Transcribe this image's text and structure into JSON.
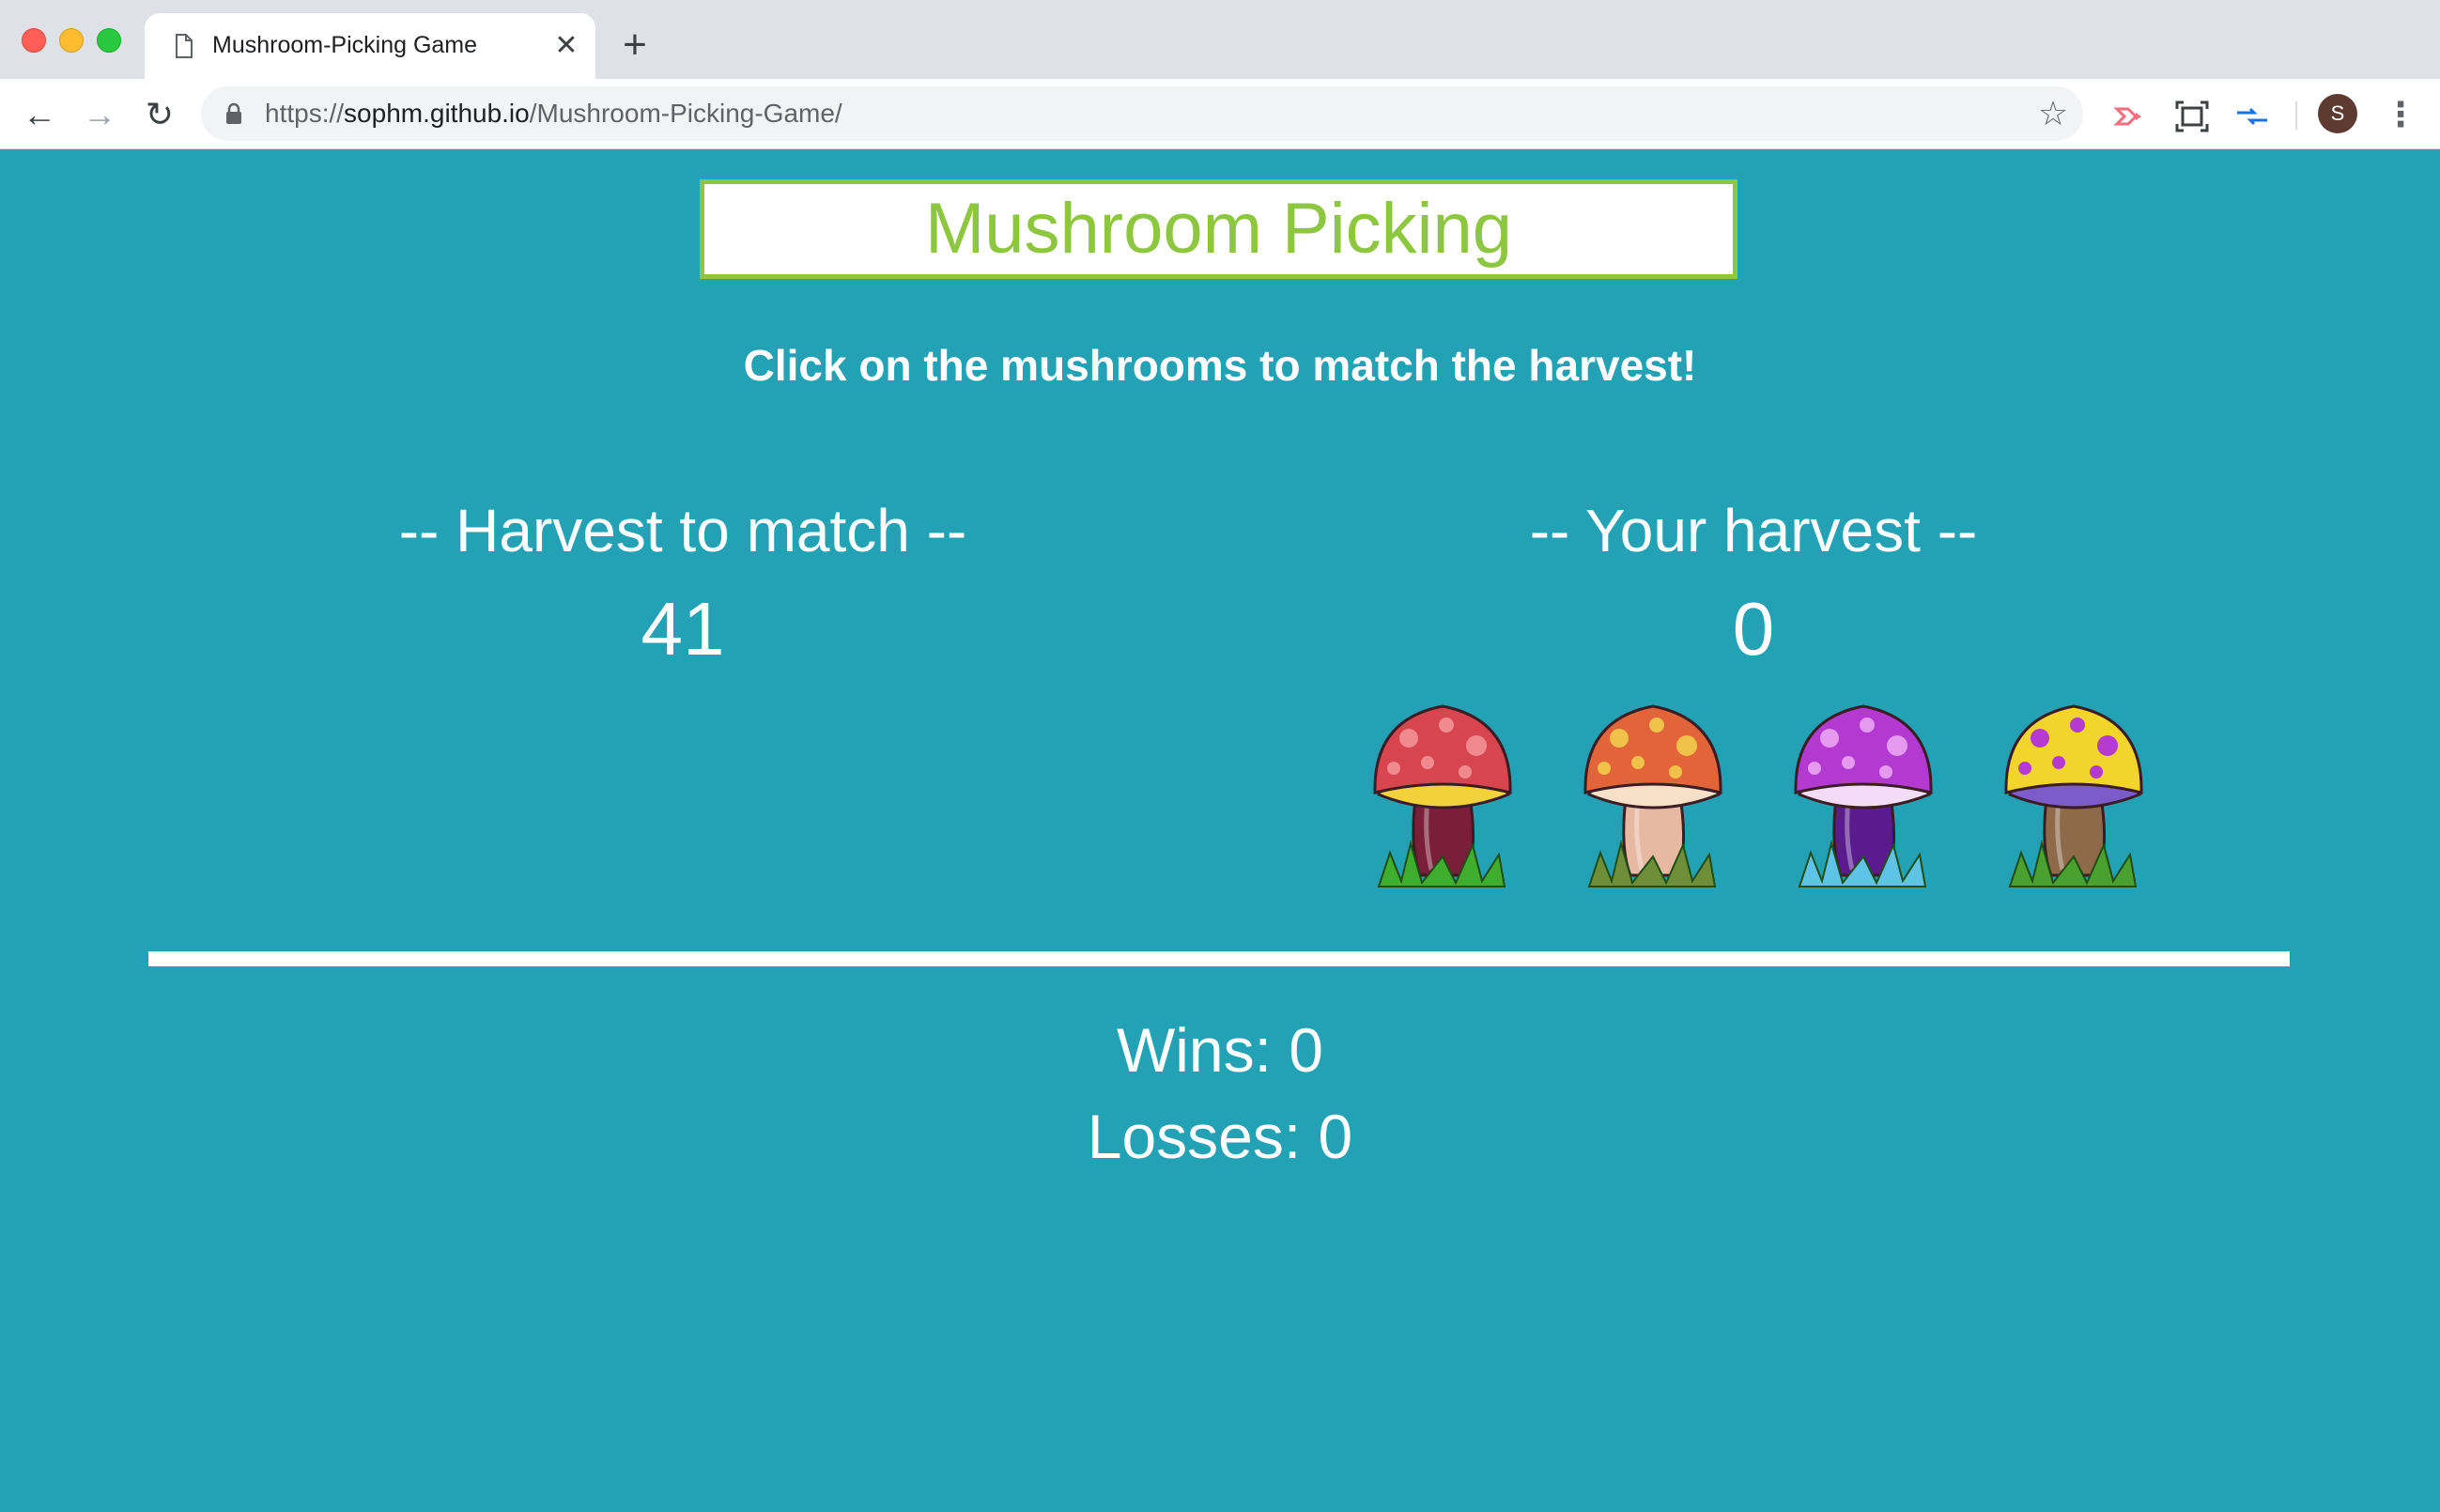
{
  "browser": {
    "tab": {
      "title": "Mushroom-Picking Game",
      "close_glyph": "✕"
    },
    "new_tab_glyph": "+",
    "url": {
      "scheme": "https://",
      "host": "sophm.github.io",
      "path": "/Mushroom-Picking-Game/"
    },
    "profile_initial": "S",
    "nav": {
      "back_glyph": "←",
      "forward_glyph": "→",
      "reload_glyph": "↻"
    },
    "bookmark_glyph": "☆",
    "menu_glyph": "⋮"
  },
  "page": {
    "title": "Mushroom Picking",
    "instructions": "Click on the mushrooms to match the harvest!",
    "target": {
      "heading": "-- Harvest to match --",
      "value": "41"
    },
    "current": {
      "heading": "-- Your harvest --",
      "value": "0"
    },
    "mushrooms": [
      {
        "name": "red-mushroom",
        "cap": "#d7454f",
        "spots": "#f08a8f",
        "gills": "#f2d23a",
        "stem": "#7a1e3a",
        "grass": "#3fae2e"
      },
      {
        "name": "orange-mushroom",
        "cap": "#e2653a",
        "spots": "#f1c24a",
        "gills": "#f6e0c8",
        "stem": "#e7b9a3",
        "grass": "#6f8e3a"
      },
      {
        "name": "purple-mushroom",
        "cap": "#b23ad1",
        "spots": "#e59af0",
        "gills": "#f3ddf6",
        "stem": "#5a1b8e",
        "grass": "#5fc3e8"
      },
      {
        "name": "yellow-mushroom",
        "cap": "#f2d52a",
        "spots": "#b43ad1",
        "gills": "#7b5cc9",
        "stem": "#8e6a4a",
        "grass": "#4aa12f"
      }
    ],
    "wins_label": "Wins: 0",
    "losses_label": "Losses: 0"
  },
  "colors": {
    "background": "#23a2b6",
    "title_accent": "#8dc63f",
    "text": "#ffffff"
  }
}
